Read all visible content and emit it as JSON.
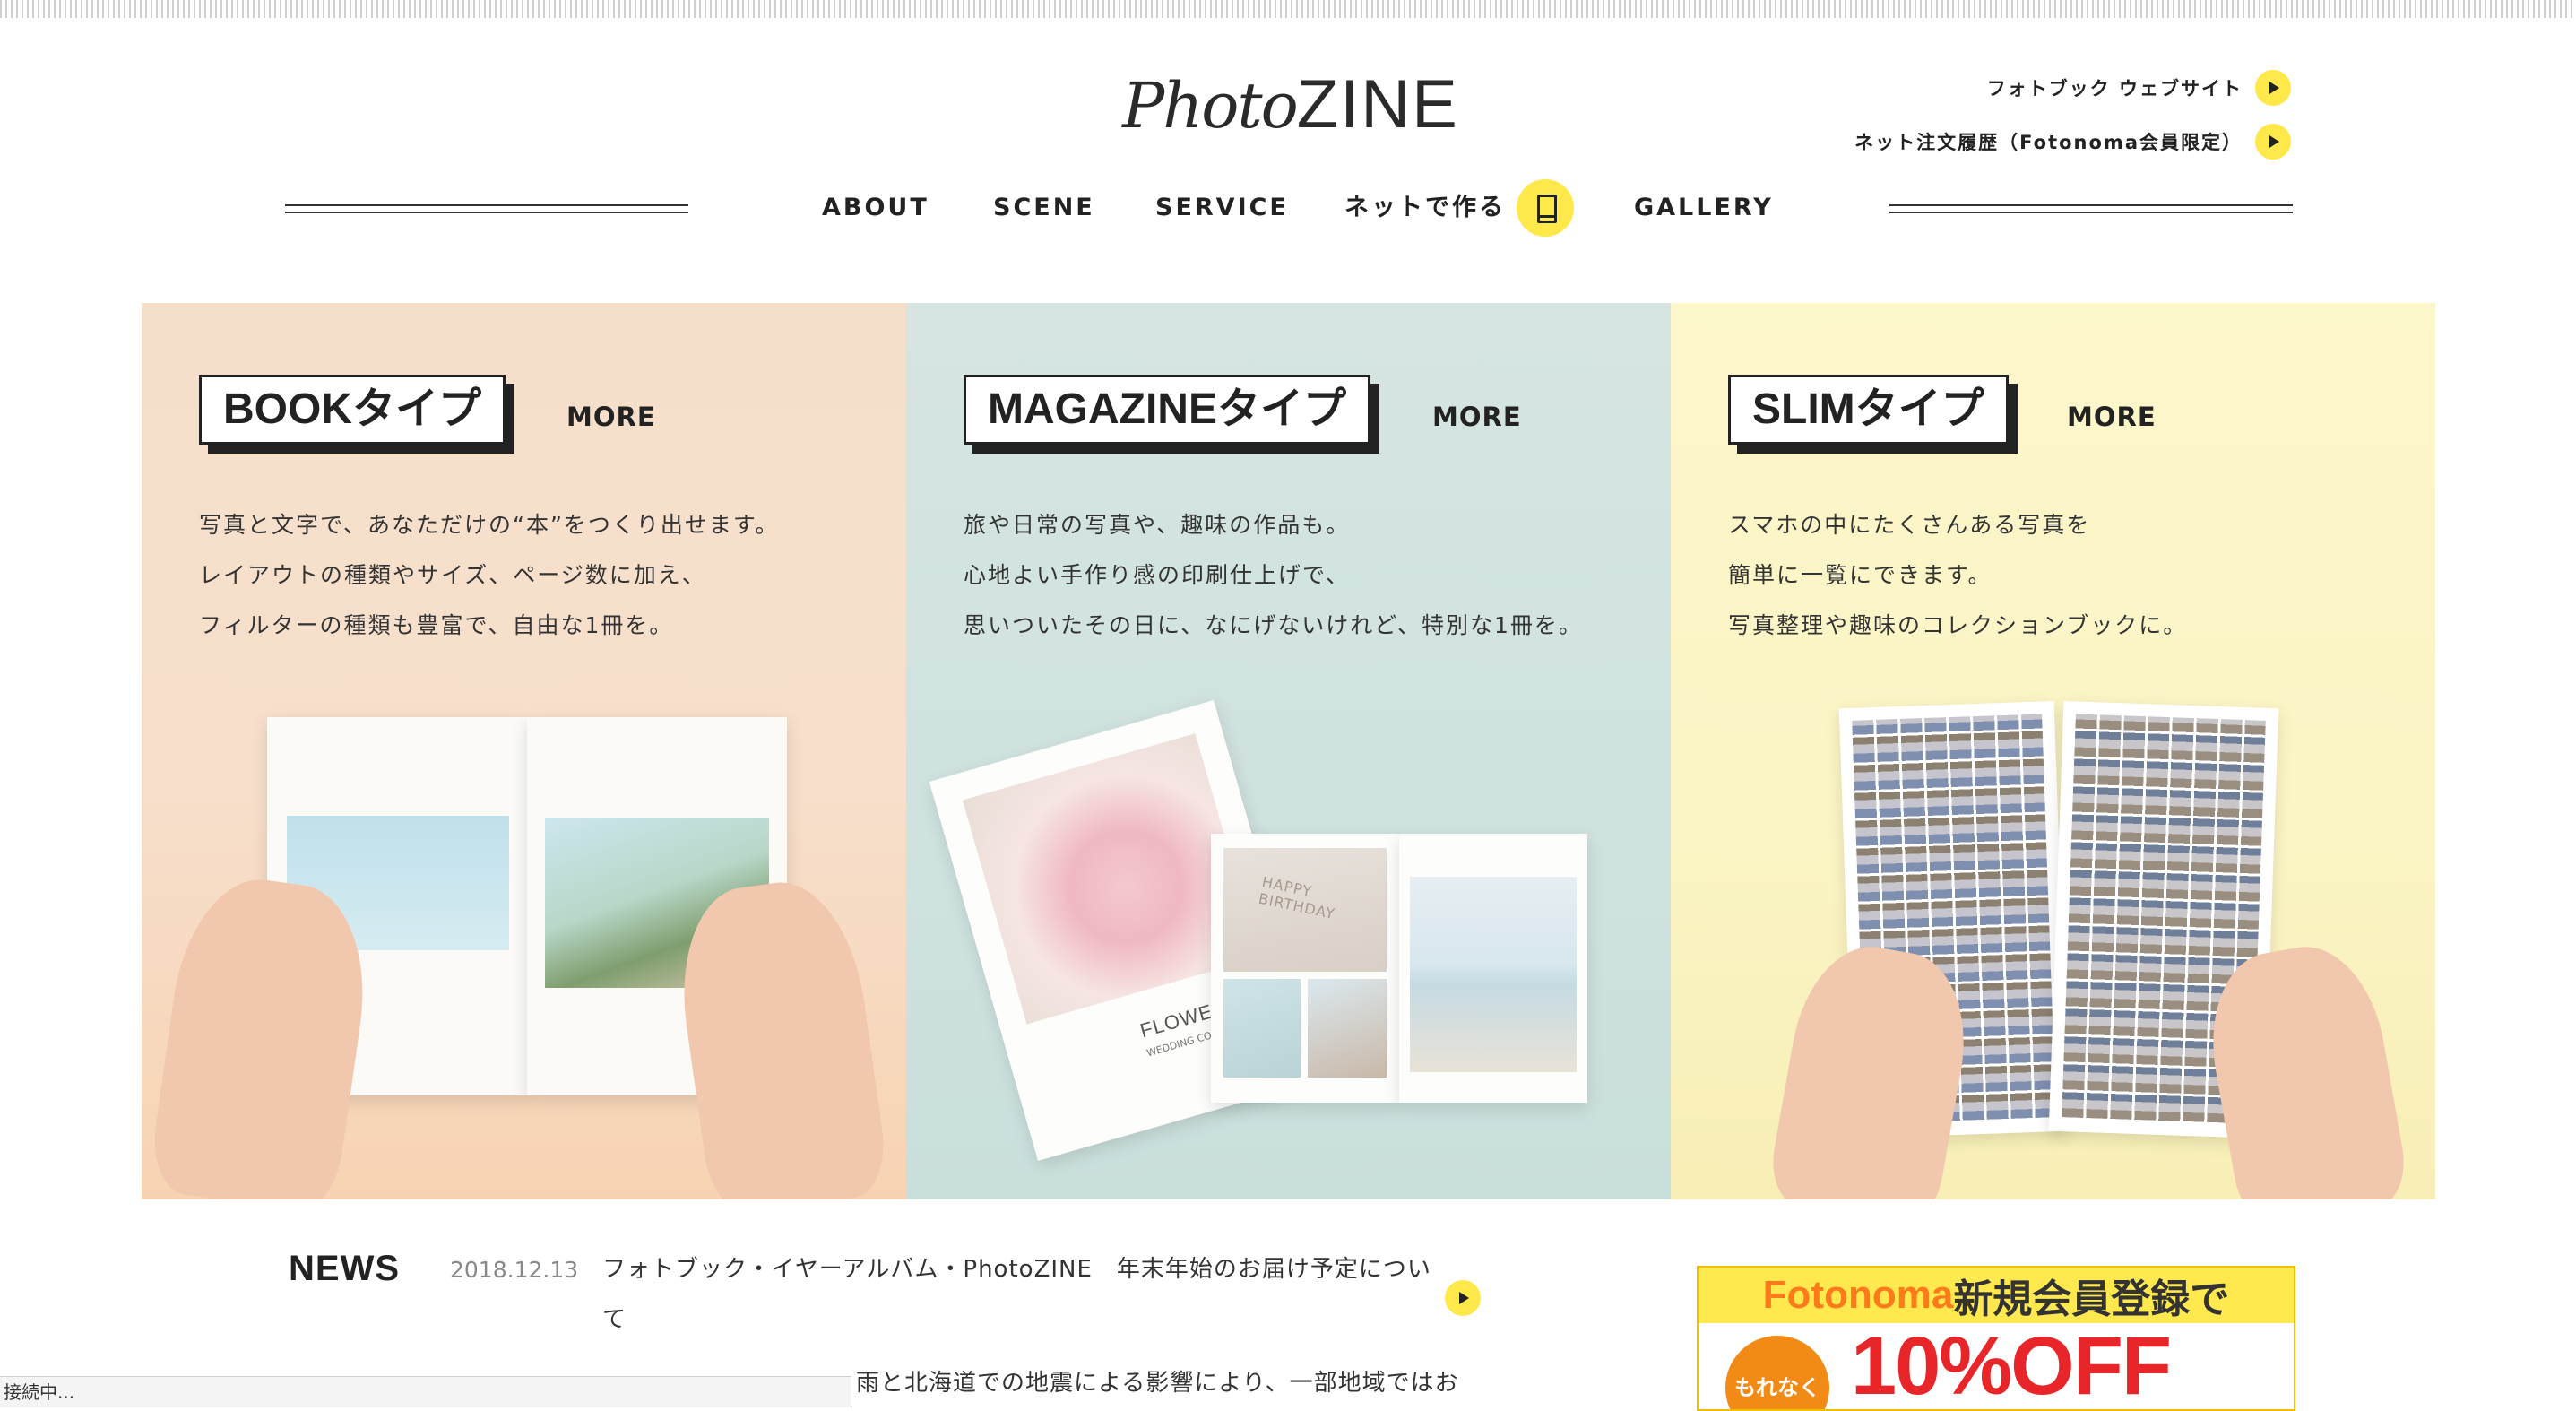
{
  "logo": {
    "photo": "Photo",
    "zine": "ZINE"
  },
  "header_links": [
    {
      "label": "フォトブック ウェブサイト"
    },
    {
      "label": "ネット注文履歴（Fotonoma会員限定）"
    }
  ],
  "nav": {
    "about": "ABOUT",
    "scene": "SCENE",
    "service": "SERVICE",
    "make": "ネットで作る",
    "gallery": "GALLERY"
  },
  "panels": [
    {
      "type_label": "BOOKタイプ",
      "more": "MORE",
      "desc": [
        "写真と文字で、あなただけの“本”をつくり出せます。",
        "レイアウトの種類やサイズ、ページ数に加え、",
        "フィルターの種類も豊富で、自由な1冊を。"
      ]
    },
    {
      "type_label": "MAGAZINEタイプ",
      "more": "MORE",
      "desc": [
        "旅や日常の写真や、趣味の作品も。",
        "心地よい手作り感の印刷仕上げで、",
        "思いついたその日に、なにげないけれど、特別な1冊を。"
      ],
      "cover_text": "FLOWER",
      "cover_subtext": "WEDDING COLL",
      "sand_text": "HAPPY BIRTHDAY"
    },
    {
      "type_label": "SLIMタイプ",
      "more": "MORE",
      "desc": [
        "スマホの中にたくさんある写真を",
        "簡単に一覧にできます。",
        "写真整理や趣味のコレクションブックに。"
      ]
    }
  ],
  "news": {
    "title": "NEWS",
    "date": "2018.12.13",
    "text": "フォトブック・イヤーアルバム・PhotoZINE　年末年始のお届け予定について",
    "text2": "雨と北海道での地震による影響により、一部地域ではお"
  },
  "banner": {
    "brand": "Fotonoma",
    "headline": " 新規会員登録で",
    "badge": "もれなく",
    "big": "10%OFF"
  },
  "status_bar": "接続中..."
}
